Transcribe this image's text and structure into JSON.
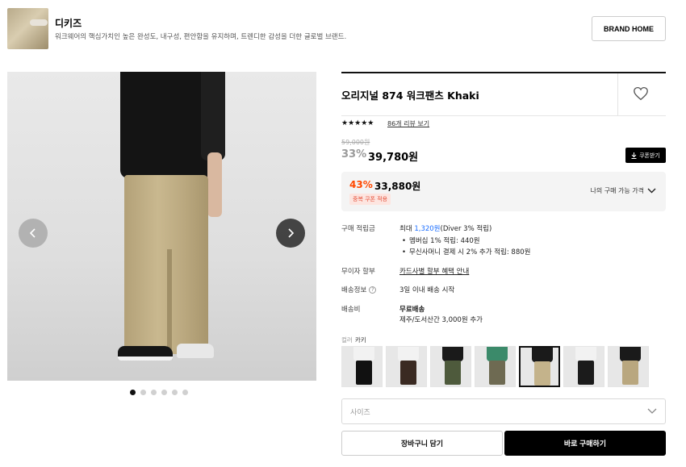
{
  "brand": {
    "name": "디키즈",
    "description": "워크웨어의 핵심가치인 높은 완성도, 내구성, 편안함을 유지하며, 트렌디한 감성을 더한 글로벌 브랜드.",
    "home_button": "BRAND HOME"
  },
  "gallery": {
    "image_count": 6,
    "active_index": 0,
    "prev_icon": "chevron-left-icon",
    "next_icon": "chevron-right-icon"
  },
  "product": {
    "title": "오리지널 874 워크팬츠 Khaki",
    "rating_stars": "★★★★★",
    "rating": 5,
    "review_link": "86개 리뷰 보기",
    "original_price": "59,000원",
    "discount_rate": "33%",
    "sale_price": "39,780원",
    "coupon_button": "쿠폰받기",
    "best": {
      "rate": "43%",
      "price": "33,880원",
      "tag": "중복 쿠폰 적용",
      "toggle_label": "나의 구매 가능 가격"
    },
    "points": {
      "label": "구매 적립금",
      "prefix": "최대 ",
      "amount": "1,320원",
      "suffix": "(Diver 3% 적립)",
      "bullet1": "멤버십 1% 적립: 440원",
      "bullet2": "무신사머니 결제 시 2% 추가 적립: 880원"
    },
    "installment": {
      "label": "무이자 할부",
      "value": "카드사별 할부 혜택 안내"
    },
    "shipping_info": {
      "label": "배송정보",
      "help_icon": "?",
      "value": "3일 이내 배송 시작"
    },
    "shipping_fee": {
      "label": "배송비",
      "value": "무료배송",
      "sub": "제주/도서산간 3,000원 추가"
    },
    "color": {
      "label": "컬러",
      "selected": "카키",
      "swatches": [
        {
          "top": "#f2f2f2",
          "bottom": "#111111"
        },
        {
          "top": "#f2f2f2",
          "bottom": "#3a2a22"
        },
        {
          "top": "#1a1a1a",
          "bottom": "#4e5a3c"
        },
        {
          "top": "#3b8a6a",
          "bottom": "#6e6a52"
        },
        {
          "top": "#1a1a1a",
          "bottom": "#c4b38b"
        },
        {
          "top": "#f2f2f2",
          "bottom": "#1b1b1b"
        },
        {
          "top": "#1a1a1a",
          "bottom": "#b9a77f"
        }
      ],
      "active_index": 4
    },
    "size_placeholder": "사이즈",
    "cart_button": "장바구니 담기",
    "buy_button": "바로 구매하기"
  },
  "colors": {
    "accent_orange": "#ff4800",
    "link_blue": "#1a6dff",
    "buy_button_bg": "#000000"
  }
}
